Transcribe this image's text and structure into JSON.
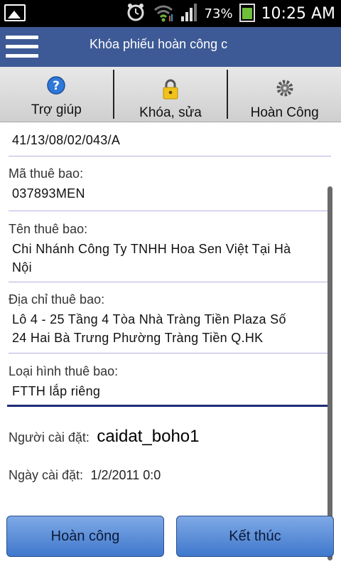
{
  "status_bar": {
    "battery_percent": "73%",
    "clock": "10:25 AM"
  },
  "app_bar": {
    "title": "Khóa phiếu hoàn công c"
  },
  "toolbar": {
    "help_label": "Trợ giúp",
    "lock_label": "Khóa, sửa",
    "complete_label": "Hoàn Công"
  },
  "form": {
    "code_value": "41/13/08/02/043/A",
    "subscriber_id_label": "Mã thuê bao:",
    "subscriber_id_value": "037893MEN",
    "subscriber_name_label": "Tên thuê bao:",
    "subscriber_name_line1": "Chi Nhánh Công Ty TNHH Hoa Sen Việt Tại Hà",
    "subscriber_name_line2": "Nội",
    "address_label": "Địa chỉ thuê bao:",
    "address_line1": "Lô 4 - 25 Tầng 4 Tòa Nhà Tràng Tiền Plaza Số",
    "address_line2": "24 Hai Bà Trưng Phường Tràng Tiền Q.HK",
    "type_label": "Loại hình thuê bao:",
    "type_value": "FTTH lắp riêng"
  },
  "info": {
    "installer_label": "Người cài đặt:",
    "installer_value": "caidat_boho1",
    "install_date_label": "Ngày cài đặt:",
    "install_date_value": "1/2/2011 0:0"
  },
  "buttons": {
    "complete": "Hoàn công",
    "finish": "Kết thúc"
  },
  "icons": {
    "status_left": "image-icon",
    "alarm": "alarm-clock-icon",
    "wifi": "wifi-icon",
    "signal": "signal-bars-icon",
    "battery": "battery-icon",
    "menu": "hamburger-menu-icon",
    "help": "help-question-icon",
    "lock": "padlock-icon",
    "gear": "gear-icon"
  },
  "colors": {
    "app_bar": "#3d5a96",
    "separator": "#b6b0e0",
    "active_separator": "#1e2b7a",
    "button": "#5a8fd8"
  }
}
